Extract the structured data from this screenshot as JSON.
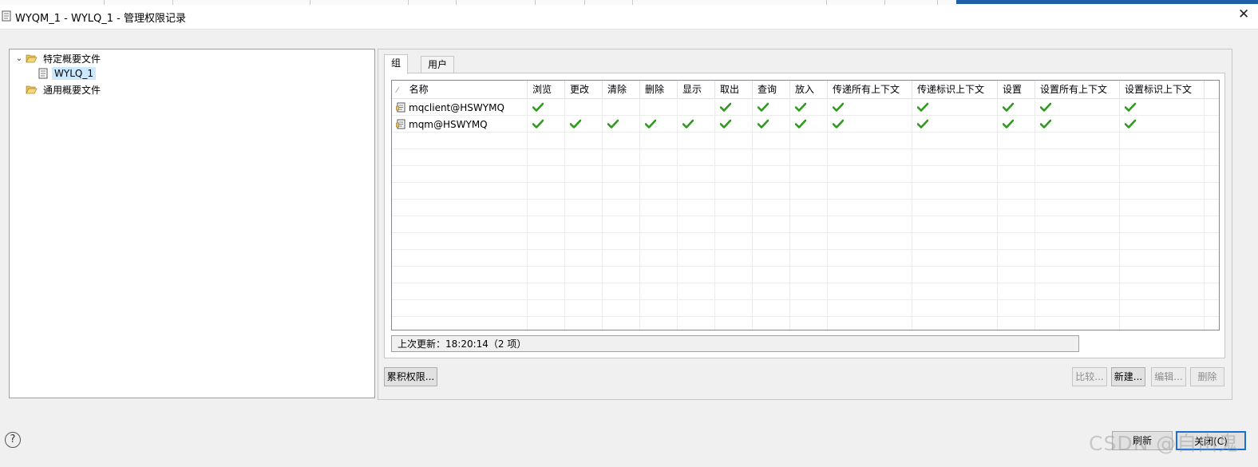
{
  "window": {
    "title": "WYQM_1 - WYLQ_1 - 管理权限记录",
    "close_glyph": "✕"
  },
  "tree": {
    "items": [
      {
        "label": "特定概要文件",
        "expanded": true
      },
      {
        "label": "WYLQ_1",
        "selected": true
      },
      {
        "label": "通用概要文件"
      }
    ],
    "expand_glyph": "⌄"
  },
  "tabs": [
    {
      "label": "组",
      "active": true
    },
    {
      "label": "用户"
    }
  ],
  "table": {
    "sort_glyph": "⁄",
    "columns": [
      "名称",
      "浏览",
      "更改",
      "清除",
      "删除",
      "显示",
      "取出",
      "查询",
      "放入",
      "传递所有上下文",
      "传递标识上下文",
      "设置",
      "设置所有上下文",
      "设置标识上下文"
    ],
    "rows": [
      {
        "name": "mqclient@HSWYMQ",
        "checks": [
          true,
          false,
          false,
          false,
          false,
          true,
          true,
          true,
          true,
          true,
          true,
          true,
          true
        ]
      },
      {
        "name": "mqm@HSWYMQ",
        "checks": [
          true,
          true,
          true,
          true,
          true,
          true,
          true,
          true,
          true,
          true,
          true,
          true,
          true
        ]
      }
    ]
  },
  "status": {
    "text": "上次更新：18:20:14（2 项）"
  },
  "buttons": {
    "cumulative": "累积权限...",
    "compare": "比较...",
    "new": "新建...",
    "edit": "编辑...",
    "delete": "删除",
    "refresh": "刷新",
    "close": "关闭(C)"
  },
  "help_glyph": "?",
  "watermark": "CSDN @自由鬼",
  "icons": [
    "document-icon",
    "folder-open-icon",
    "folder-icon",
    "user-group-icon",
    "check-icon",
    "help-icon",
    "close-icon"
  ],
  "colors": {
    "check": "#2f9a1e",
    "selection": "#cce8ff",
    "default_button_border": "#1a6fd1",
    "top_strip_blue": "#1e5fa8"
  }
}
